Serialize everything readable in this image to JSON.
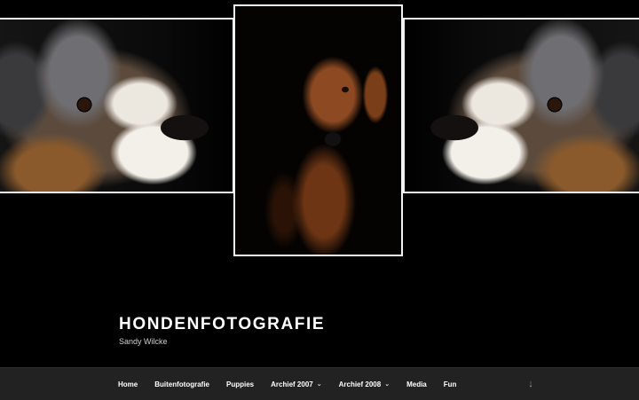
{
  "site": {
    "title": "HONDENFOTOGRAFIE",
    "description": "Sandy Wilcke"
  },
  "header_images": [
    {
      "name": "aussie-puppy-left"
    },
    {
      "name": "ridgeback-center"
    },
    {
      "name": "aussie-puppy-right"
    }
  ],
  "nav": {
    "items": [
      {
        "label": "Home",
        "has_submenu": false
      },
      {
        "label": "Buitenfotografie",
        "has_submenu": false
      },
      {
        "label": "Puppies",
        "has_submenu": false
      },
      {
        "label": "Archief 2007",
        "has_submenu": true
      },
      {
        "label": "Archief 2008",
        "has_submenu": true
      },
      {
        "label": "Media",
        "has_submenu": false
      },
      {
        "label": "Fun",
        "has_submenu": false
      }
    ],
    "submenu_icon": "chevron-down-icon",
    "scroll_icon": "arrow-down-icon",
    "scroll_glyph": "↓"
  },
  "colors": {
    "background": "#000000",
    "nav_background": "#222222",
    "photo_border": "#f2f2f2",
    "text": "#ffffff"
  }
}
